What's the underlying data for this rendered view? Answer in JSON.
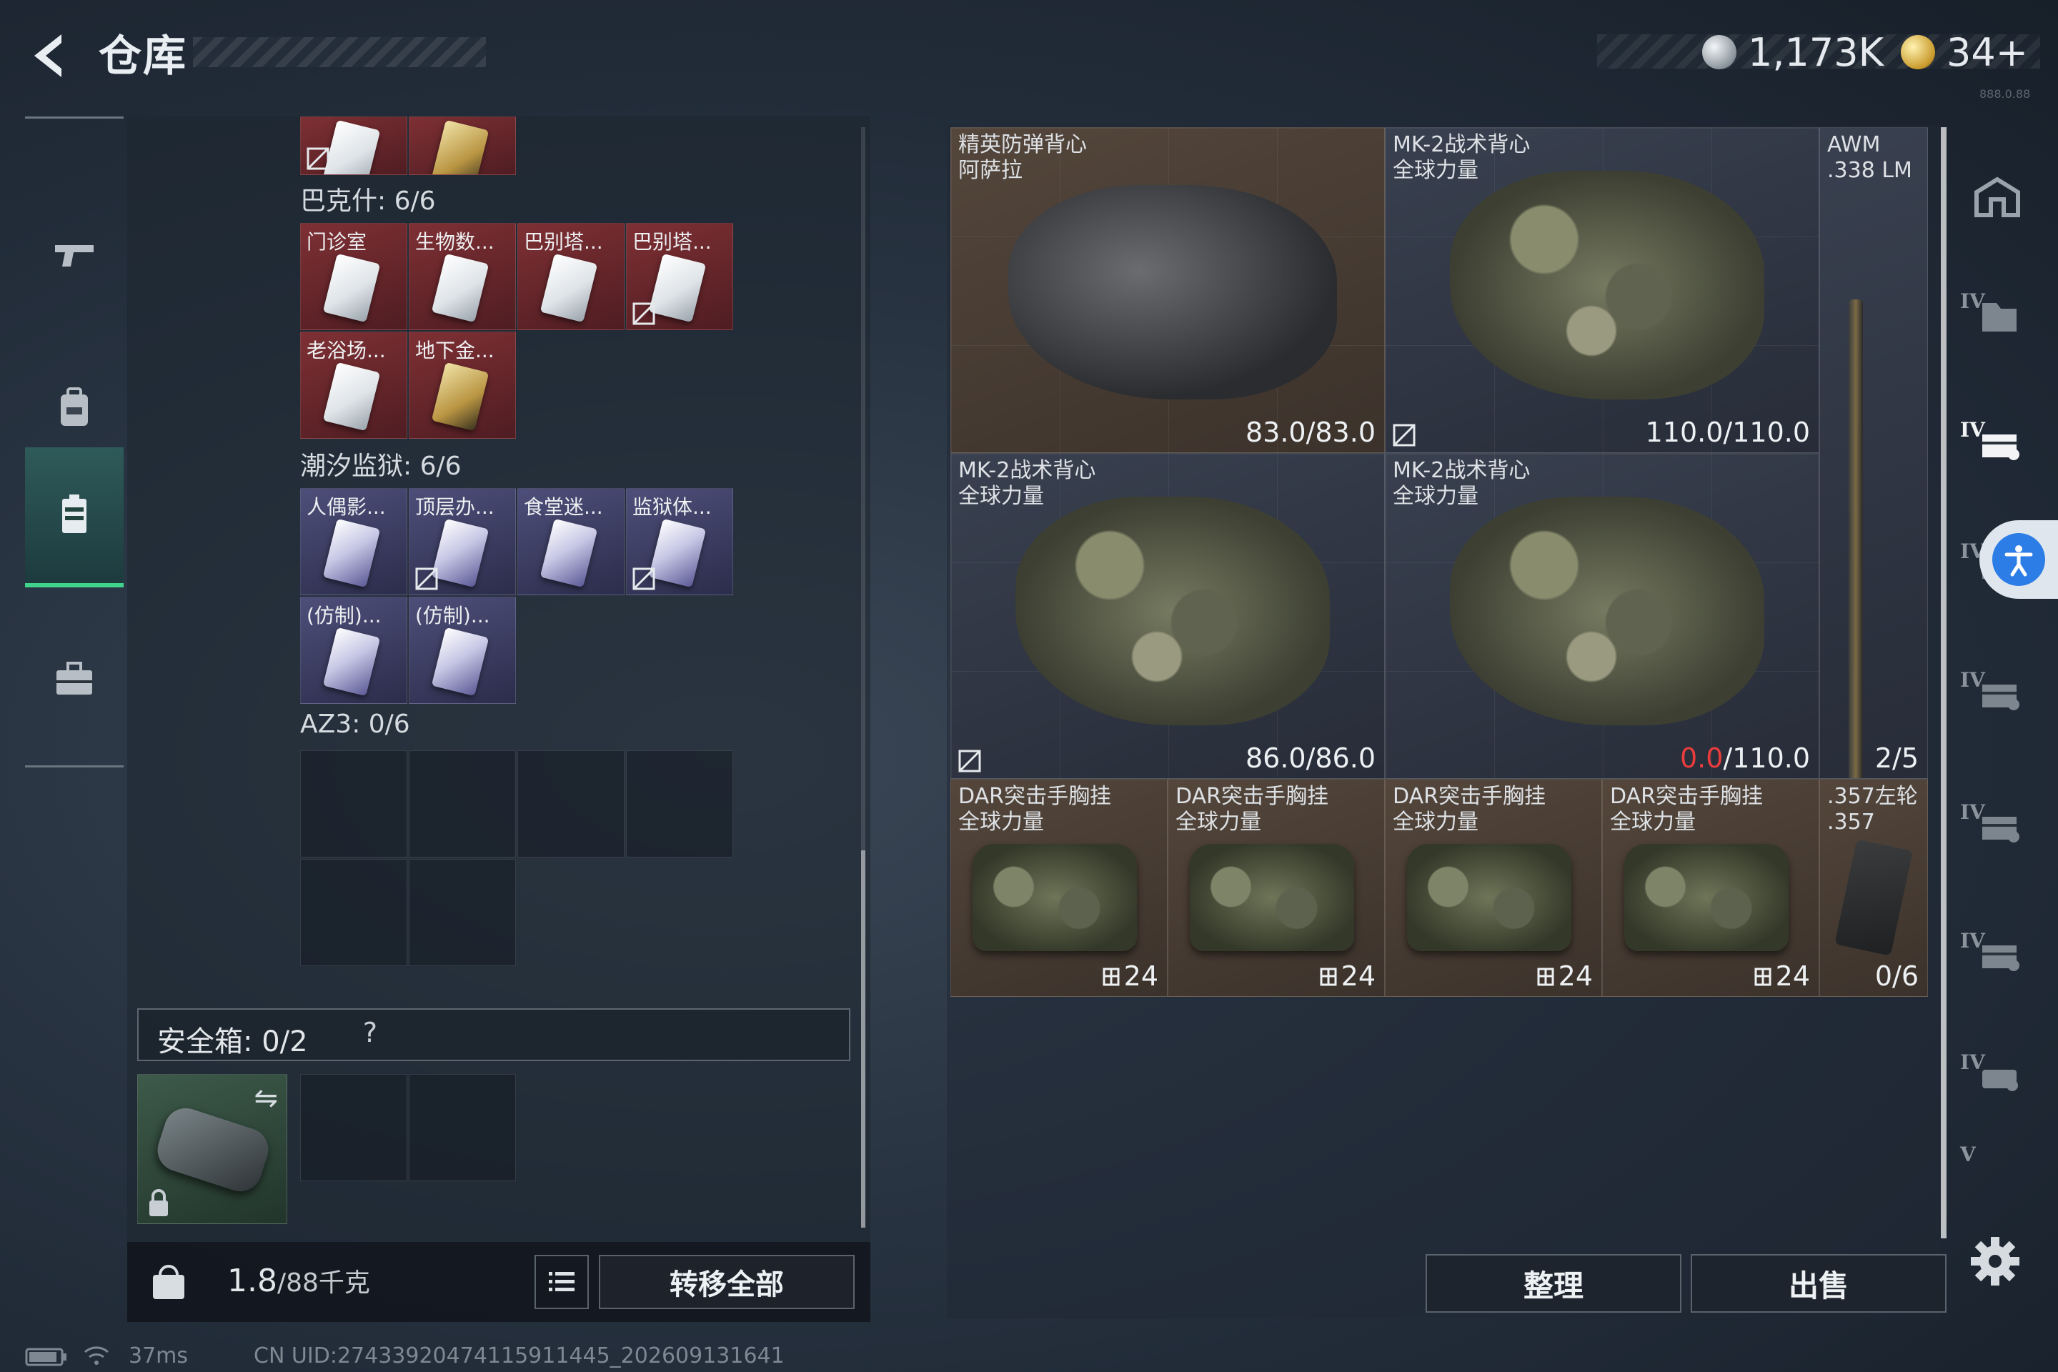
{
  "header": {
    "title": "仓库",
    "currency_silver": "1,173K",
    "currency_gold": "34+",
    "version_tag": "888.0.88"
  },
  "left": {
    "sections": [
      {
        "label": "巴克什: 6/6",
        "items": [
          {
            "label": "门诊室",
            "color": "red",
            "card": "white",
            "nosell": false
          },
          {
            "label": "生物数...",
            "color": "red",
            "card": "white",
            "nosell": false
          },
          {
            "label": "巴别塔...",
            "color": "red",
            "card": "white",
            "nosell": false
          },
          {
            "label": "巴别塔...",
            "color": "red",
            "card": "white",
            "nosell": true
          },
          {
            "label": "老浴场...",
            "color": "red",
            "card": "white",
            "nosell": false
          },
          {
            "label": "地下金...",
            "color": "red",
            "card": "gold",
            "nosell": false
          }
        ]
      },
      {
        "label": "潮汐监狱: 6/6",
        "items": [
          {
            "label": "人偶影...",
            "color": "blue",
            "card": "purple",
            "nosell": false
          },
          {
            "label": "顶层办...",
            "color": "blue",
            "card": "purple",
            "nosell": true
          },
          {
            "label": "食堂迷...",
            "color": "blue",
            "card": "purple",
            "nosell": false
          },
          {
            "label": "监狱体...",
            "color": "blue",
            "card": "purple",
            "nosell": true
          },
          {
            "label": "(仿制)...",
            "color": "blue",
            "card": "purple",
            "nosell": false
          },
          {
            "label": "(仿制)...",
            "color": "blue",
            "card": "purple",
            "nosell": false
          }
        ]
      },
      {
        "label": "AZ3: 0/6",
        "items": []
      }
    ],
    "safe_box_label": "安全箱: 0/2",
    "safe_box_help": "?",
    "weight_value": "1.8",
    "weight_max": "/88千克",
    "weight_icon_text": "KG",
    "transfer_all": "转移全部"
  },
  "stash": {
    "items": [
      {
        "name": "精英防弹背心\n阿萨拉",
        "durability": "83.0/83.0"
      },
      {
        "name": "MK-2战术背心\n全球力量",
        "durability": "110.0/110.0"
      },
      {
        "name": "AWM\n.338 LM",
        "count": "2/5"
      },
      {
        "name": "MK-2战术背心\n全球力量",
        "durability": "86.0/86.0"
      },
      {
        "name": "MK-2战术背心\n全球力量",
        "durability_current": "0.0",
        "durability_max": "/110.0"
      },
      {
        "name": "DAR突击手胸挂\n全球力量",
        "slots": "24"
      },
      {
        "name": "DAR突击手胸挂\n全球力量",
        "slots": "24"
      },
      {
        "name": "DAR突击手胸挂\n全球力量",
        "slots": "24"
      },
      {
        "name": "DAR突击手胸挂\n全球力量",
        "slots": "24"
      },
      {
        "name": ".357左轮\n.357",
        "count": "0/6"
      }
    ],
    "sort_label": "整理",
    "sell_label": "出售"
  },
  "tabs": [
    "IV",
    "IV",
    "IV",
    "IV",
    "IV",
    "IV",
    "IV",
    "V"
  ],
  "status": {
    "ping": "37ms",
    "uid": "CN UID:27433920474115911445_202609131641"
  },
  "colors": {
    "accent_green": "#3fd38b",
    "durability_red": "#ea3c3c",
    "red_cell": "#7e3034",
    "blue_cell": "#4d4f7a",
    "brown_cell": "#54463b"
  }
}
